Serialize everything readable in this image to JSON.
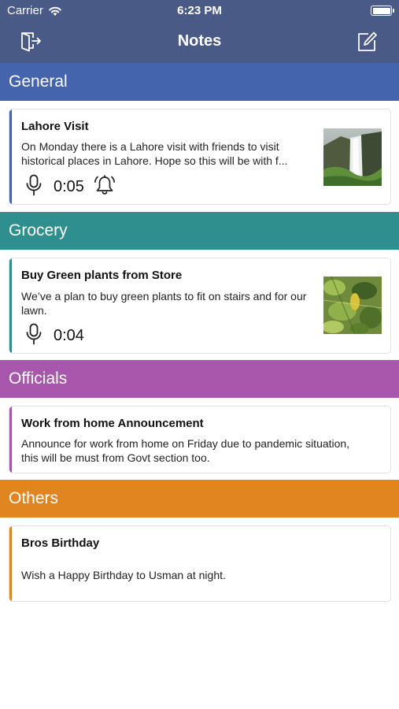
{
  "status_bar": {
    "carrier": "Carrier",
    "time": "6:23 PM"
  },
  "nav": {
    "title": "Notes",
    "left_icon": "logout-icon",
    "right_icon": "compose-icon"
  },
  "colors": {
    "nav_bg": "#4a5a86",
    "general": "#4464ae",
    "grocery": "#2f8f8f",
    "officials": "#a857ad",
    "others": "#e08520"
  },
  "sections": [
    {
      "name": "General",
      "notes": [
        {
          "title": "Lahore Visit",
          "body": "On Monday there is a Lahore visit with friends to visit historical places in Lahore. Hope so this will be with f...",
          "audio_duration": "0:05",
          "has_reminder": true,
          "thumbnail": "waterfall-photo"
        }
      ]
    },
    {
      "name": "Grocery",
      "notes": [
        {
          "title": "Buy Green plants from Store",
          "body": "We’ve a plan to buy green plants to fit on stairs and for our lawn.",
          "audio_duration": "0:04",
          "has_reminder": false,
          "thumbnail": "green-plant-photo"
        }
      ]
    },
    {
      "name": "Officials",
      "notes": [
        {
          "title": "Work from home Announcement",
          "body": "Announce for work from home on Friday due to pandemic situation, this will be must from Govt section too."
        }
      ]
    },
    {
      "name": "Others",
      "notes": [
        {
          "title": "Bros Birthday",
          "body": "Wish a Happy Birthday to Usman at night."
        }
      ]
    }
  ]
}
